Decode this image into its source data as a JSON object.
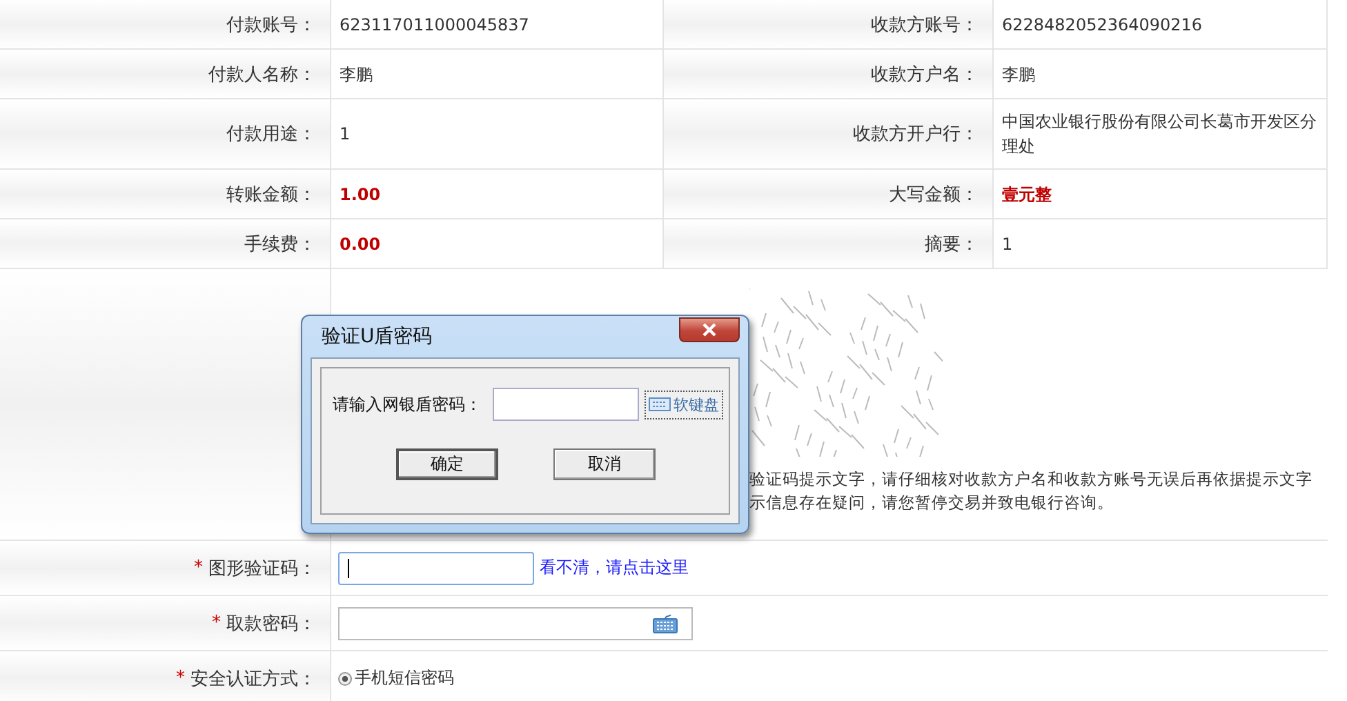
{
  "rows": [
    {
      "cells": [
        {
          "label": "付款账号：",
          "value": "623117011000045837",
          "kind": "plain"
        },
        {
          "label": "收款方账号：",
          "value": "6228482052364090216",
          "kind": "plain"
        }
      ]
    },
    {
      "cells": [
        {
          "label": "付款人名称：",
          "value": "李鹏",
          "kind": "plain"
        },
        {
          "label": "收款方户名：",
          "value": "李鹏",
          "kind": "plain"
        }
      ]
    },
    {
      "cells": [
        {
          "label": "付款用途：",
          "value": "1",
          "kind": "plain"
        },
        {
          "label": "收款方开户行：",
          "value": "中国农业银行股份有限公司长葛市开发区分理处",
          "kind": "plain"
        }
      ]
    },
    {
      "cells": [
        {
          "label": "转账金额：",
          "value": "1.00",
          "kind": "amount"
        },
        {
          "label": "大写金额：",
          "value": "壹元整",
          "kind": "amount"
        }
      ]
    },
    {
      "cells": [
        {
          "label": "手续费：",
          "value": "0.00",
          "kind": "amount"
        },
        {
          "label": "摘要：",
          "value": "1",
          "kind": "plain"
        }
      ]
    }
  ],
  "captcha_section": {
    "hint_lines": [
      "验证码提示文字，请仔细核对收款方户名和收款方账号无误后再依据提示文字",
      "示信息存在疑问，请您暂停交易并致电银行咨询。"
    ]
  },
  "form_rows": [
    {
      "required_mark": "*",
      "label": "图形验证码：",
      "kind": "captcha",
      "focused": true,
      "link": "看不清，请点击这里"
    },
    {
      "required_mark": "*",
      "label": "取款密码：",
      "kind": "password",
      "focused": false
    },
    {
      "required_mark": "*",
      "label": "安全认证方式：",
      "kind": "radio",
      "options": [
        {
          "label": "手机短信密码",
          "selected": true
        }
      ]
    }
  ],
  "dialog": {
    "title": "验证U盾密码",
    "field_label": "请输入网银盾密码：",
    "keyboard_button": "软键盘",
    "buttons": [
      "确定",
      "取消"
    ]
  }
}
